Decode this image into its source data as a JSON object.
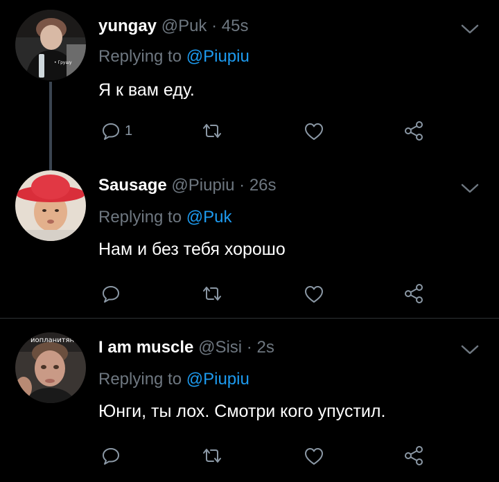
{
  "tweets": [
    {
      "name": "yungay",
      "handle": "@Puk",
      "time": "45s",
      "replying_label": "Replying to",
      "replying_to": "@Piupiu",
      "text": "Я к вам еду.",
      "avatar_caption": "• Грушу",
      "reply_count": "1"
    },
    {
      "name": "Sausage",
      "handle": "@Piupiu",
      "time": "26s",
      "replying_label": "Replying to",
      "replying_to": "@Puk",
      "text": "Нам и без тебя хорошо",
      "reply_count": ""
    },
    {
      "name": "I am muscle",
      "handle": "@Sisi",
      "time": "2s",
      "replying_label": "Replying to",
      "replying_to": "@Piupiu",
      "text": "Юнги, ты лох. Смотри кого упустил.",
      "avatar_caption": "иопланитян",
      "reply_count": ""
    }
  ],
  "separator": "·",
  "colors": {
    "background": "#000000",
    "name": "#ffffff",
    "meta": "#6e7780",
    "mention": "#1d9bf0",
    "icon": "#8b98a5",
    "thread_line": "#3a4450"
  },
  "icons": [
    "reply-icon",
    "retweet-icon",
    "like-icon",
    "share-icon",
    "chevron-down-icon"
  ]
}
